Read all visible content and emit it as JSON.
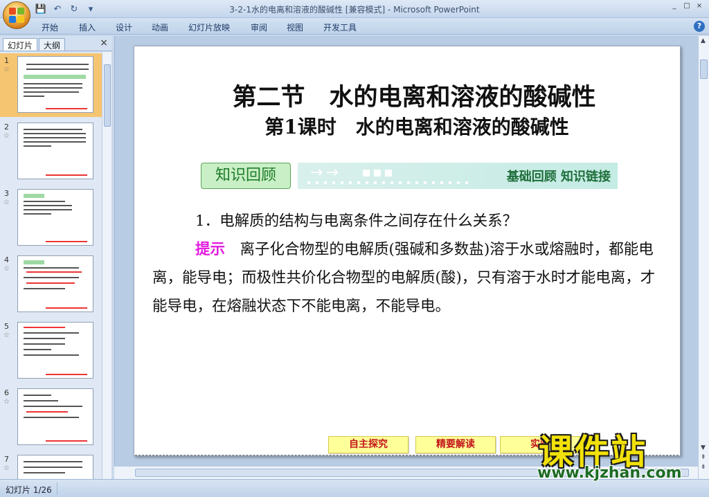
{
  "window": {
    "title": "3-2-1水的电离和溶液的酸碱性 [兼容模式] - Microsoft PowerPoint",
    "controls": [
      "_",
      "□",
      "×"
    ]
  },
  "ribbon": {
    "tabs": [
      "开始",
      "插入",
      "设计",
      "动画",
      "幻灯片放映",
      "审阅",
      "视图",
      "开发工具"
    ]
  },
  "pane": {
    "tabs": [
      "幻灯片",
      "大纲"
    ],
    "close": "×",
    "slides": [
      {
        "num": "1",
        "star": "☆"
      },
      {
        "num": "2",
        "star": "☆"
      },
      {
        "num": "3",
        "star": "☆"
      },
      {
        "num": "4",
        "star": "☆"
      },
      {
        "num": "5",
        "star": "☆"
      },
      {
        "num": "6",
        "star": "☆"
      },
      {
        "num": "7",
        "star": "☆"
      }
    ]
  },
  "slide": {
    "title_line1": "第二节　水的电离和溶液的酸碱性",
    "title_line2": "第1课时　水的电离和溶液的酸碱性",
    "banner_label": "知识回顾",
    "banner_right": "基础回顾  知识链接",
    "banner_arrows": "→→",
    "question": "1．电解质的结构与电离条件之间存在什么关系？",
    "hint_label": "提示",
    "hint_text": "　离子化合物型的电解质(强碱和多数盐)溶于水或熔融时，都能电离，能导电；而极性共价化合物型的电解质(酸)，只有溶于水时才能电离，才能导电，在熔融状态下不能电离，不能导电。",
    "nav_buttons": [
      "自主探究",
      "精要解读",
      "实验"
    ]
  },
  "watermark": {
    "text": "课件站",
    "url": "www.kjzhan.com"
  },
  "status": {
    "slide_info": "幻灯片 1/26"
  },
  "colors": {
    "hint": "#e21ce0",
    "nav_text": "#c4161c",
    "nav_bg": "#ffff99",
    "selected_thumb": "#f6c571"
  }
}
